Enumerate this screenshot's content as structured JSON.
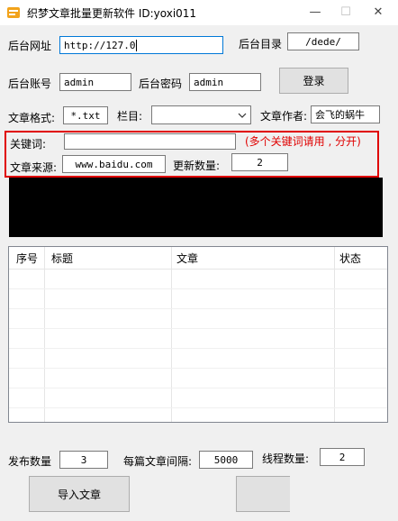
{
  "window": {
    "title": "织梦文章批量更新软件   ID:yoxi011",
    "minimize": "—",
    "maximize": "☐",
    "close": "✕"
  },
  "login": {
    "url_label": "后台网址",
    "url_value": "http://127.0",
    "dir_label": "后台目录",
    "dir_value": "/dede/",
    "user_label": "后台账号",
    "user_value": "admin",
    "pass_label": "后台密码",
    "pass_value": "admin",
    "login_button": "登录"
  },
  "article": {
    "format_label": "文章格式:",
    "format_value": "*.txt",
    "column_label": "栏目:",
    "column_value": "",
    "author_label": "文章作者:",
    "author_value": "会飞的蜗牛"
  },
  "keywords": {
    "keyword_label": "关键词:",
    "keyword_value": "",
    "hint": "(多个关键词请用 , 分开)",
    "source_label": "文章来源:",
    "source_value": "www.baidu.com",
    "update_count_label": "更新数量:",
    "update_count_value": "2"
  },
  "table": {
    "columns": [
      "序号",
      "标题",
      "文章",
      "状态"
    ],
    "rows": []
  },
  "bottom": {
    "publish_label": "发布数量",
    "publish_value": "3",
    "interval_label": "每篇文章间隔:",
    "interval_value": "5000",
    "threads_label": "线程数量:",
    "threads_value": "2",
    "import_button": "导入文章",
    "second_button": ""
  },
  "colors": {
    "highlight_border": "#e00000",
    "hint_text": "#e00000",
    "log_bg": "#000000"
  },
  "icons": {
    "app": "app-icon",
    "dropdown": "chevron-down-icon"
  }
}
